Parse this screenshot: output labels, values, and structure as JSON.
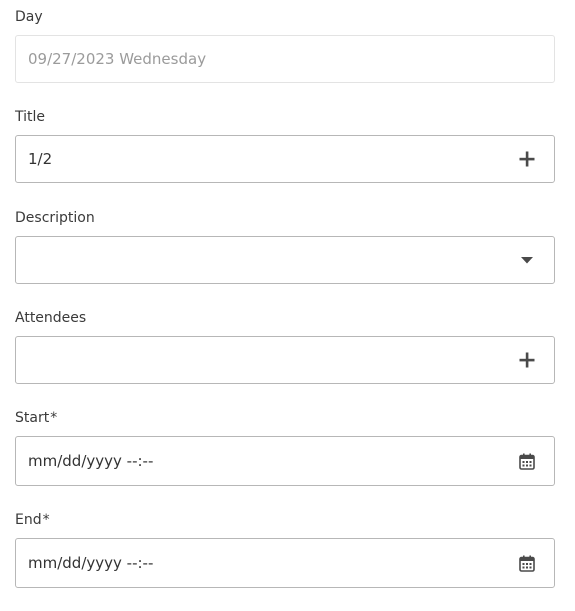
{
  "form": {
    "day": {
      "label": "Day",
      "value": "09/27/2023 Wednesday"
    },
    "title": {
      "label": "Title",
      "value": "1/2",
      "action_icon": "plus-icon"
    },
    "description": {
      "label": "Description",
      "value": "",
      "action_icon": "caret-down-icon"
    },
    "attendees": {
      "label": "Attendees",
      "value": "",
      "action_icon": "plus-icon"
    },
    "start": {
      "label": "Start",
      "required_marker": "*",
      "placeholder": "mm/dd/yyyy --:--",
      "action_icon": "calendar-icon"
    },
    "end": {
      "label": "End",
      "required_marker": "*",
      "placeholder": "mm/dd/yyyy --:--",
      "action_icon": "calendar-icon"
    }
  },
  "colors": {
    "text": "#333333",
    "muted_text": "#9b9b9b",
    "border": "#b7b7b7",
    "readonly_border": "#e3e3e3",
    "icon": "#4a4a4a"
  }
}
